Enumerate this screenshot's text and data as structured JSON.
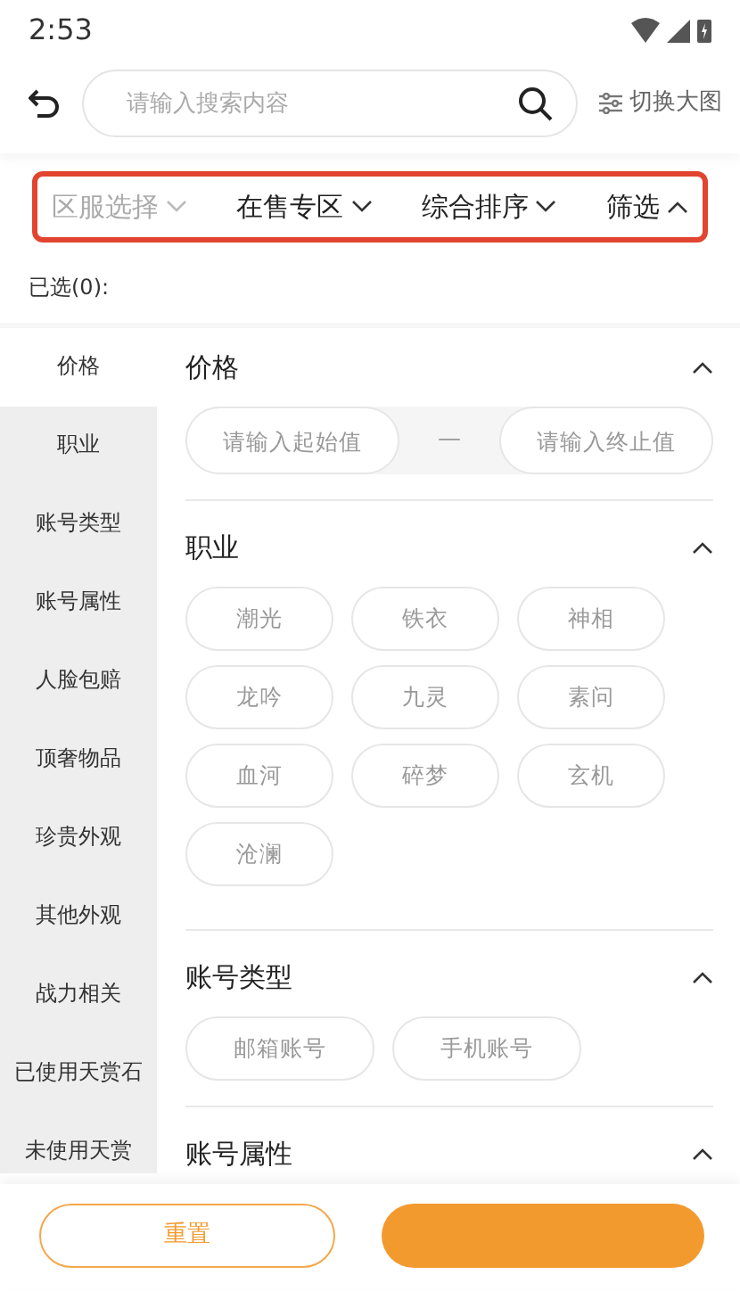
{
  "status_bar": {
    "time": "2:53"
  },
  "search": {
    "placeholder": "请输入搜索内容",
    "switch_label": "切换大图"
  },
  "filter_bar": {
    "highlighted": true,
    "tabs": [
      {
        "label": "区服选择",
        "disabled": true,
        "expanded": false
      },
      {
        "label": "在售专区",
        "disabled": false,
        "expanded": false
      },
      {
        "label": "综合排序",
        "disabled": false,
        "expanded": false
      },
      {
        "label": "筛选",
        "disabled": false,
        "expanded": true
      }
    ]
  },
  "selected_summary": "已选(0):",
  "sidebar": {
    "items": [
      {
        "label": "价格",
        "selected": true
      },
      {
        "label": "职业",
        "selected": false
      },
      {
        "label": "账号类型",
        "selected": false
      },
      {
        "label": "账号属性",
        "selected": false
      },
      {
        "label": "人脸包赔",
        "selected": false
      },
      {
        "label": "顶奢物品",
        "selected": false
      },
      {
        "label": "珍贵外观",
        "selected": false
      },
      {
        "label": "其他外观",
        "selected": false
      },
      {
        "label": "战力相关",
        "selected": false
      },
      {
        "label": "已使用天赏石",
        "selected": false
      },
      {
        "label": "未使用天赏",
        "selected": false
      }
    ]
  },
  "sections": [
    {
      "title": "价格",
      "kind": "range",
      "expanded": true,
      "min_placeholder": "请输入起始值",
      "separator": "—",
      "max_placeholder": "请输入终止值"
    },
    {
      "title": "职业",
      "kind": "options",
      "expanded": true,
      "options": [
        {
          "label": "潮光",
          "selected": false
        },
        {
          "label": "铁衣",
          "selected": false
        },
        {
          "label": "神相",
          "selected": false
        },
        {
          "label": "龙吟",
          "selected": false
        },
        {
          "label": "九灵",
          "selected": false
        },
        {
          "label": "素问",
          "selected": false
        },
        {
          "label": "血河",
          "selected": false
        },
        {
          "label": "碎梦",
          "selected": false
        },
        {
          "label": "玄机",
          "selected": false
        },
        {
          "label": "沧澜",
          "selected": false
        }
      ]
    },
    {
      "title": "账号类型",
      "kind": "options",
      "expanded": true,
      "options": [
        {
          "label": "邮箱账号",
          "selected": false
        },
        {
          "label": "手机账号",
          "selected": false
        }
      ]
    },
    {
      "title": "账号属性",
      "kind": "options",
      "expanded": true
    }
  ],
  "footer": {
    "reset_label": "重置"
  }
}
